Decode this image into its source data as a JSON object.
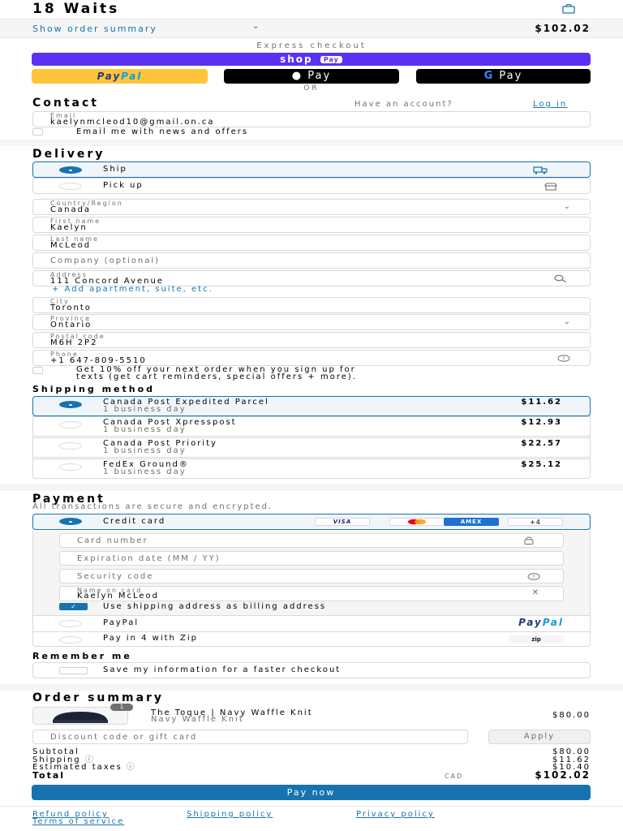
{
  "header": {
    "brand": "18 Waits",
    "cart_icon": "shopping-bag-icon"
  },
  "order_summary_toggle": {
    "label": "Show order summary",
    "total": "$102.02"
  },
  "express": {
    "label": "Express checkout",
    "shop_pay": "shop",
    "shop_pay_badge": "Pay",
    "paypal_1": "Pay",
    "paypal_2": "Pal",
    "apple_pay": " Pay",
    "google_pay_g": "G",
    "google_pay": " Pay",
    "or": "OR"
  },
  "contact": {
    "title": "Contact",
    "have_account": "Have an account?",
    "login": "Log in",
    "email_label": "Email",
    "email_value": "kaelynmcleod10@gmail.on.ca",
    "news_label": "Email me with news and offers"
  },
  "delivery": {
    "title": "Delivery",
    "ship_label": "Ship",
    "pickup_label": "Pick up",
    "country_label": "Country/Region",
    "country_value": "Canada",
    "first_name_label": "First name",
    "first_name_value": "Kaelyn",
    "last_name_label": "Last name",
    "last_name_value": "McLeod",
    "company_placeholder": "Company (optional)",
    "address_label": "Address",
    "address_value": "111 Concord Avenue",
    "add_apartment": "+ Add apartment, suite, etc.",
    "city_label": "City",
    "city_value": "Toronto",
    "province_label": "Province",
    "province_value": "Ontario",
    "postal_label": "Postal code",
    "postal_value": "M6H 2P2",
    "phone_label": "Phone",
    "phone_value": "+1 647-809-5510",
    "sms_offer_1": "Get 10% off your next order when you sign up for",
    "sms_offer_2": "texts (get cart reminders, special offers + more)."
  },
  "shipping": {
    "title": "Shipping method",
    "options": [
      {
        "name": "Canada Post Expedited Parcel",
        "eta": "1 business day",
        "price": "$11.62",
        "selected": true
      },
      {
        "name": "Canada Post Xpresspost",
        "eta": "1 business day",
        "price": "$12.93",
        "selected": false
      },
      {
        "name": "Canada Post Priority",
        "eta": "1 business day",
        "price": "$22.57",
        "selected": false
      },
      {
        "name": "FedEx Ground®",
        "eta": "1 business day",
        "price": "$25.12",
        "selected": false
      }
    ]
  },
  "payment": {
    "title": "Payment",
    "subtitle": "All transactions are secure and encrypted.",
    "credit_card_label": "Credit card",
    "card_brands": [
      "VISA",
      "AMEX",
      "+4"
    ],
    "card_number_placeholder": "Card number",
    "expiration_placeholder": "Expiration date (MM / YY)",
    "security_placeholder": "Security code",
    "name_on_card_label": "Name on card",
    "name_on_card_value": "Kaelyn McLeod",
    "billing_same_label": "Use shipping address as billing address",
    "paypal_label": "PayPal",
    "paypal_logo_1": "Pay",
    "paypal_logo_2": "Pal",
    "zip_label": "Pay in 4 with Zip",
    "zip_logo": "zip"
  },
  "remember": {
    "title": "Remember me",
    "save_label": "Save my information for a faster checkout"
  },
  "summary": {
    "title": "Order summary",
    "item_name": "The Toque | Navy Waffle Knit",
    "item_variant": "Navy Waffle Knit",
    "item_qty": "1",
    "item_price": "$80.00",
    "discount_placeholder": "Discount code or gift card",
    "apply_label": "Apply",
    "subtotal_label": "Subtotal",
    "subtotal_value": "$80.00",
    "shipping_label": "Shipping",
    "shipping_value": "$11.62",
    "taxes_label": "Estimated taxes",
    "taxes_value": "$10.40",
    "total_label": "Total",
    "currency": "CAD",
    "total_value": "$102.02",
    "pay_now": "Pay now"
  },
  "footer": {
    "links": [
      "Refund policy",
      "Shipping policy",
      "Privacy policy",
      "Terms of service"
    ]
  },
  "colors": {
    "accent": "#1773b0",
    "shop_pay": "#5a31f4",
    "paypal_yellow": "#ffc439"
  }
}
